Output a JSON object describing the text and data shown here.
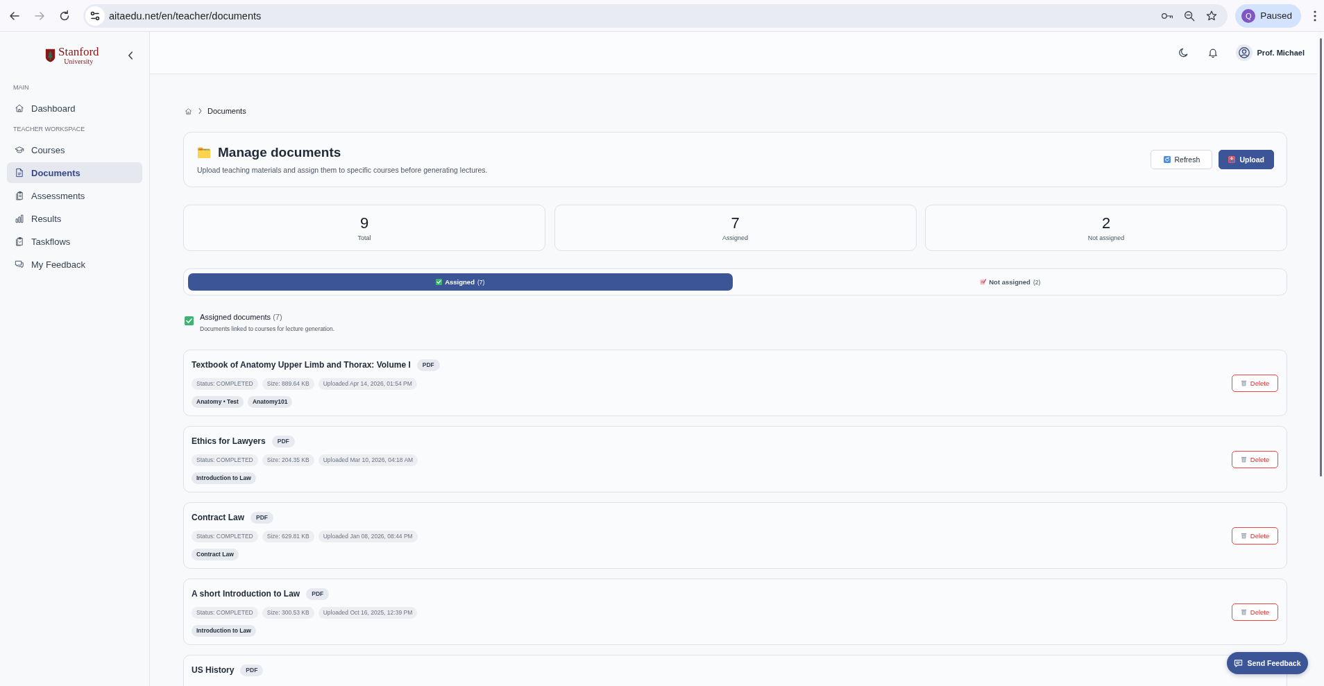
{
  "browser": {
    "url": "aitaedu.net/en/teacher/documents",
    "forward_disabled": true,
    "profile_initial": "Q",
    "profile_status": "Paused"
  },
  "sidebar": {
    "logo": {
      "name": "Stanford",
      "subtitle": "University"
    },
    "sections": [
      {
        "label": "MAIN",
        "items": [
          {
            "label": "Dashboard",
            "selected": false
          }
        ]
      },
      {
        "label": "TEACHER WORKSPACE",
        "items": [
          {
            "label": "Courses",
            "selected": false
          },
          {
            "label": "Documents",
            "selected": true
          },
          {
            "label": "Assessments",
            "selected": false
          },
          {
            "label": "Results",
            "selected": false
          },
          {
            "label": "Taskflows",
            "selected": false
          },
          {
            "label": "My Feedback",
            "selected": false
          }
        ]
      }
    ]
  },
  "header": {
    "user_name": "Prof. Michael"
  },
  "breadcrumb": {
    "current": "Documents"
  },
  "page": {
    "title": "Manage documents",
    "description": "Upload teaching materials and assign them to specific courses before generating lectures.",
    "buttons": [
      {
        "label": "Refresh",
        "kind": "secondary"
      },
      {
        "label": "Upload",
        "kind": "primary"
      }
    ]
  },
  "stats": [
    {
      "value": "9",
      "label": "Total"
    },
    {
      "value": "7",
      "label": "Assigned"
    },
    {
      "value": "2",
      "label": "Not assigned"
    }
  ],
  "tabs": [
    {
      "label": "Assigned",
      "count": "(7)",
      "selected": true
    },
    {
      "label": "Not assigned",
      "count": "(2)",
      "selected": false
    }
  ],
  "section": {
    "title": "Assigned documents",
    "count": "(7)",
    "description": "Documents linked to courses for lecture generation."
  },
  "documents": [
    {
      "title": "Textbook of Anatomy Upper Limb and Thorax: Volume I",
      "type": "PDF",
      "meta": [
        "Status: COMPLETED",
        "Size: 889.64 KB",
        "Uploaded Apr 14, 2026, 01:54 PM"
      ],
      "courses": [
        "Anatomy • Test",
        "Anatomy101"
      ],
      "action": "Delete"
    },
    {
      "title": "Ethics for Lawyers",
      "type": "PDF",
      "meta": [
        "Status: COMPLETED",
        "Size: 204.35 KB",
        "Uploaded Mar 10, 2026, 04:18 AM"
      ],
      "courses": [
        "Introduction to Law"
      ],
      "action": "Delete"
    },
    {
      "title": "Contract Law",
      "type": "PDF",
      "meta": [
        "Status: COMPLETED",
        "Size: 629.81 KB",
        "Uploaded Jan 08, 2026, 08:44 PM"
      ],
      "courses": [
        "Contract Law"
      ],
      "action": "Delete"
    },
    {
      "title": "A short Introduction to Law",
      "type": "PDF",
      "meta": [
        "Status: COMPLETED",
        "Size: 300.53 KB",
        "Uploaded Oct 16, 2025, 12:39 PM"
      ],
      "courses": [
        "Introduction to Law"
      ],
      "action": "Delete"
    },
    {
      "title": "US History",
      "type": "PDF"
    }
  ],
  "feedback_button": {
    "label": "Send Feedback"
  }
}
